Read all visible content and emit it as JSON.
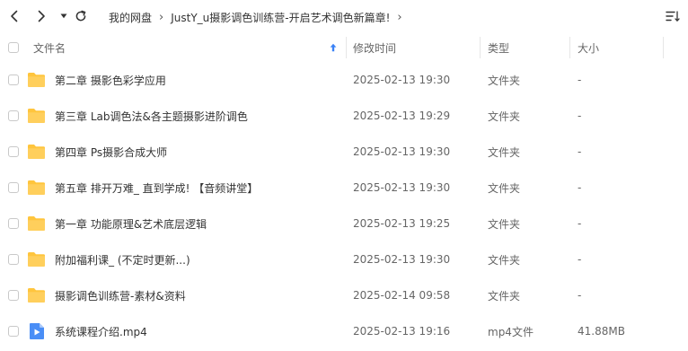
{
  "toolbar": {
    "back_icon": "chevron-left-icon",
    "forward_icon": "chevron-right-icon",
    "history_icon": "caret-down-icon",
    "refresh_icon": "refresh-icon",
    "sort_menu_icon": "sort-lines-icon",
    "breadcrumb": [
      "我的网盘",
      "JustY_u摄影调色训练营-开启艺术调色新篇章!"
    ]
  },
  "header": {
    "name": "文件名",
    "modified": "修改时间",
    "type": "类型",
    "size": "大小",
    "sort_icon": "sort-up-arrow-icon"
  },
  "colors": {
    "folder": "#FFC53D",
    "video": "#4A8EF6",
    "sort_arrow": "#3b82f6"
  },
  "files": [
    {
      "name": "第二章 摄影色彩学应用",
      "modified": "2025-02-13 19:30",
      "type": "文件夹",
      "size": "-",
      "icon": "folder-icon"
    },
    {
      "name": "第三章 Lab调色法&各主题摄影进阶调色",
      "modified": "2025-02-13 19:29",
      "type": "文件夹",
      "size": "-",
      "icon": "folder-icon"
    },
    {
      "name": "第四章 Ps摄影合成大师",
      "modified": "2025-02-13 19:30",
      "type": "文件夹",
      "size": "-",
      "icon": "folder-icon"
    },
    {
      "name": "第五章 排开万难_ 直到学成! 【音频讲堂】",
      "modified": "2025-02-13 19:30",
      "type": "文件夹",
      "size": "-",
      "icon": "folder-icon"
    },
    {
      "name": "第一章 功能原理&艺术底层逻辑",
      "modified": "2025-02-13 19:25",
      "type": "文件夹",
      "size": "-",
      "icon": "folder-icon"
    },
    {
      "name": "附加福利课_ (不定时更新...)",
      "modified": "2025-02-13 19:30",
      "type": "文件夹",
      "size": "-",
      "icon": "folder-icon"
    },
    {
      "name": "摄影调色训练营-素材&资料",
      "modified": "2025-02-14 09:58",
      "type": "文件夹",
      "size": "-",
      "icon": "folder-icon"
    },
    {
      "name": "系统课程介绍.mp4",
      "modified": "2025-02-13 19:16",
      "type": "mp4文件",
      "size": "41.88MB",
      "icon": "video-file-icon"
    }
  ]
}
